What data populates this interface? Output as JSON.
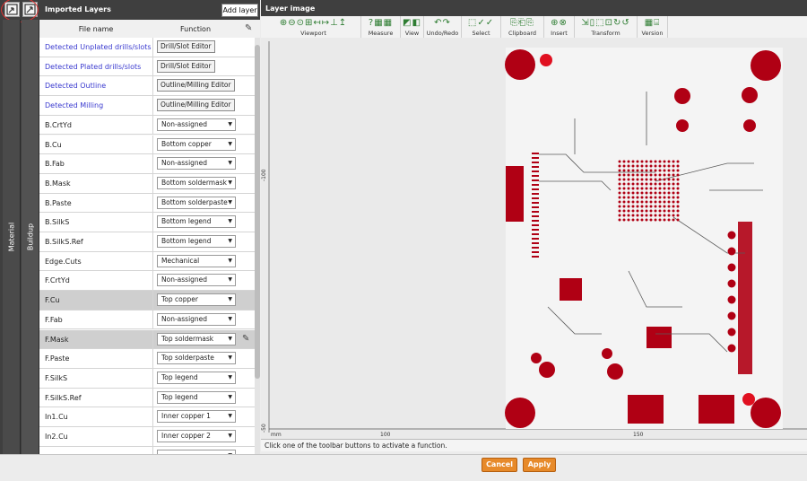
{
  "sidebar": {
    "material_tab": "Material",
    "buildup_tab": "Buildup"
  },
  "layers_panel": {
    "title": "Imported Layers",
    "add_layer_label": "Add layer",
    "columns": {
      "file_name": "File name",
      "function": "Function"
    },
    "rows": [
      {
        "file": "Detected Unplated drills/slots",
        "link": true,
        "button": "Drill/Slot Editor"
      },
      {
        "file": "Detected Plated drills/slots",
        "link": true,
        "button": "Drill/Slot Editor"
      },
      {
        "file": "Detected Outline",
        "link": true,
        "button": "Outline/Milling Editor"
      },
      {
        "file": "Detected Milling",
        "link": true,
        "button": "Outline/Milling Editor"
      },
      {
        "file": "B.CrtYd",
        "function": "Non-assigned"
      },
      {
        "file": "B.Cu",
        "function": "Bottom copper"
      },
      {
        "file": "B.Fab",
        "function": "Non-assigned"
      },
      {
        "file": "B.Mask",
        "function": "Bottom soldermask"
      },
      {
        "file": "B.Paste",
        "function": "Bottom solderpaste"
      },
      {
        "file": "B.SilkS",
        "function": "Bottom legend"
      },
      {
        "file": "B.SilkS.Ref",
        "function": "Bottom legend"
      },
      {
        "file": "Edge.Cuts",
        "function": "Mechanical"
      },
      {
        "file": "F.CrtYd",
        "function": "Non-assigned"
      },
      {
        "file": "F.Cu",
        "function": "Top copper",
        "selected": true
      },
      {
        "file": "F.Fab",
        "function": "Non-assigned"
      },
      {
        "file": "F.Mask",
        "function": "Top soldermask",
        "selected": true,
        "edit": true
      },
      {
        "file": "F.Paste",
        "function": "Top solderpaste"
      },
      {
        "file": "F.SilkS",
        "function": "Top legend"
      },
      {
        "file": "F.SilkS.Ref",
        "function": "Top legend"
      },
      {
        "file": "In1.Cu",
        "function": "Inner copper 1"
      },
      {
        "file": "In2.Cu",
        "function": "Inner copper 2"
      },
      {
        "file": "",
        "function": ""
      }
    ]
  },
  "image_panel": {
    "title": "Layer image",
    "toolbar_groups": [
      {
        "label": "Viewport",
        "icons": "⊕⊖⊙⊞↤↦⊥↥",
        "icon_name": "viewport-icons"
      },
      {
        "label": "Measure",
        "icons": "?▦▦",
        "icon_name": "measure-icons"
      },
      {
        "label": "View",
        "icons": "◩◧",
        "icon_name": "view-icons"
      },
      {
        "label": "Undo/Redo",
        "icons": "↶↷",
        "icon_name": "undo-redo-icons"
      },
      {
        "label": "Select",
        "icons": "⬚✓✓",
        "icon_name": "select-icons"
      },
      {
        "label": "Clipboard",
        "icons": "⎘⎗⎘",
        "icon_name": "clipboard-icons"
      },
      {
        "label": "Insert",
        "icons": "⊕⊗",
        "icon_name": "insert-icons"
      },
      {
        "label": "Transform",
        "icons": "⇲▯⬚⊡↻↺",
        "icon_name": "transform-icons"
      },
      {
        "label": "Version",
        "icons": "▦⌸",
        "icon_name": "version-icons"
      }
    ],
    "axis_labels": {
      "left_top": "-100",
      "left_bottom": "-50",
      "bottom_unit": "mm",
      "bottom_100": "100",
      "bottom_150": "150"
    },
    "status": "Click one of the toolbar buttons to activate a function."
  },
  "footer": {
    "cancel": "Cancel",
    "apply": "Apply"
  },
  "colors": {
    "pcb_red": "#b00014",
    "accent_orange": "#e78a2a",
    "dark_panel": "#3f3f3f"
  }
}
